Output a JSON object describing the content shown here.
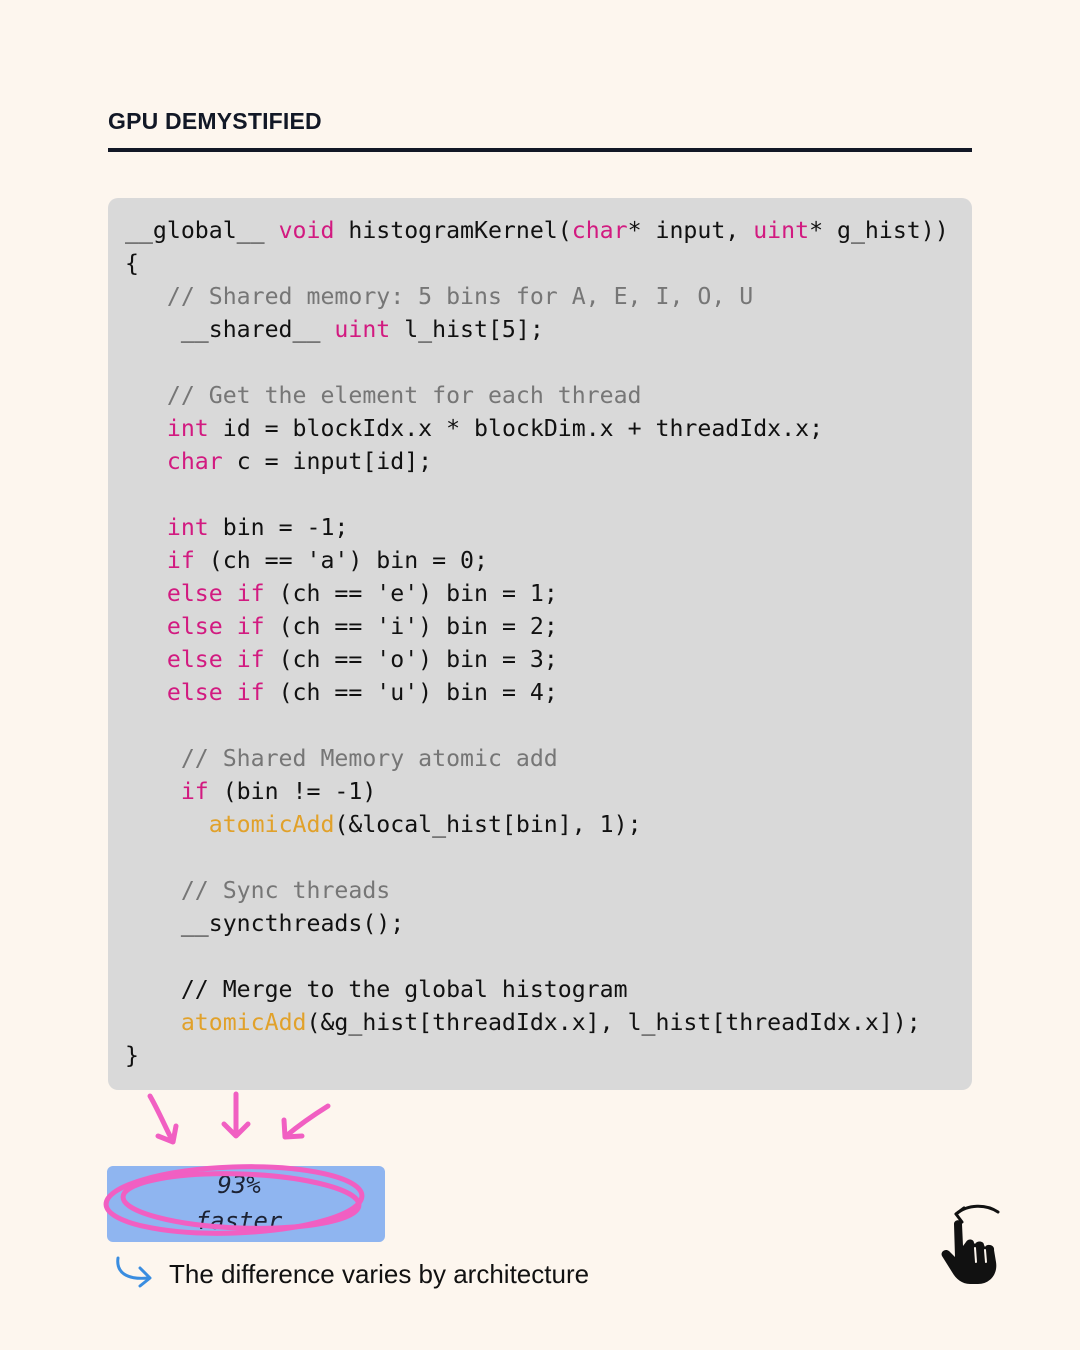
{
  "header": {
    "title": "GPU DEMYSTIFIED"
  },
  "code": {
    "lines": [
      [
        [
          "t",
          "__global__ "
        ],
        [
          "k",
          "void"
        ],
        [
          "t",
          " histogramKernel("
        ],
        [
          "k",
          "char"
        ],
        [
          "t",
          "* input, "
        ],
        [
          "k",
          "uint"
        ],
        [
          "t",
          "* g_hist))"
        ]
      ],
      [
        [
          "t",
          "{"
        ]
      ],
      [
        [
          "c",
          "   // Shared memory: 5 bins for A, E, I, O, U"
        ]
      ],
      [
        [
          "t",
          "    __shared__ "
        ],
        [
          "k",
          "uint"
        ],
        [
          "t",
          " l_hist[5];"
        ]
      ],
      [],
      [
        [
          "c",
          "   // Get the element for each thread"
        ]
      ],
      [
        [
          "t",
          "   "
        ],
        [
          "k",
          "int"
        ],
        [
          "t",
          " id = blockIdx.x * blockDim.x + threadIdx.x;"
        ]
      ],
      [
        [
          "t",
          "   "
        ],
        [
          "k",
          "char"
        ],
        [
          "t",
          " c = input[id];"
        ]
      ],
      [],
      [
        [
          "t",
          "   "
        ],
        [
          "k",
          "int"
        ],
        [
          "t",
          " bin = -1;"
        ]
      ],
      [
        [
          "t",
          "   "
        ],
        [
          "k",
          "if"
        ],
        [
          "t",
          " (ch == 'a') bin = 0;"
        ]
      ],
      [
        [
          "t",
          "   "
        ],
        [
          "k",
          "else if"
        ],
        [
          "t",
          " (ch == 'e') bin = 1;"
        ]
      ],
      [
        [
          "t",
          "   "
        ],
        [
          "k",
          "else if"
        ],
        [
          "t",
          " (ch == 'i') bin = 2;"
        ]
      ],
      [
        [
          "t",
          "   "
        ],
        [
          "k",
          "else if"
        ],
        [
          "t",
          " (ch == 'o') bin = 3;"
        ]
      ],
      [
        [
          "t",
          "   "
        ],
        [
          "k",
          "else if"
        ],
        [
          "t",
          " (ch == 'u') bin = 4;"
        ]
      ],
      [],
      [
        [
          "c",
          "    // Shared Memory atomic add"
        ]
      ],
      [
        [
          "t",
          "    "
        ],
        [
          "k",
          "if"
        ],
        [
          "t",
          " (bin != -1)"
        ]
      ],
      [
        [
          "t",
          "      "
        ],
        [
          "f",
          "atomicAdd"
        ],
        [
          "t",
          "(&local_hist[bin], 1);"
        ]
      ],
      [],
      [
        [
          "c",
          "    // Sync threads"
        ]
      ],
      [
        [
          "t",
          "    __syncthreads();"
        ]
      ],
      [],
      [
        [
          "t",
          "    // Merge to the global histogram"
        ]
      ],
      [
        [
          "t",
          "    "
        ],
        [
          "f",
          "atomicAdd"
        ],
        [
          "t",
          "(&g_hist[threadIdx.x], l_hist[threadIdx.x]);"
        ]
      ],
      [
        [
          "t",
          "}"
        ]
      ]
    ]
  },
  "badge": {
    "line1": "93%",
    "line2": "faster"
  },
  "note": {
    "text": "The difference varies by architecture"
  },
  "icons": {
    "down_arrows": "arrow-down-icon",
    "note_arrow": "curved-arrow-icon",
    "swipe": "swipe-hand-icon"
  },
  "colors": {
    "background": "#fdf6ee",
    "code_bg": "#d9d9d9",
    "keyword": "#d21a80",
    "function": "#e1a12a",
    "comment": "#767676",
    "badge": "#8fb5f0",
    "scribble": "#f15fc2",
    "note_arrow": "#3a8de0"
  }
}
